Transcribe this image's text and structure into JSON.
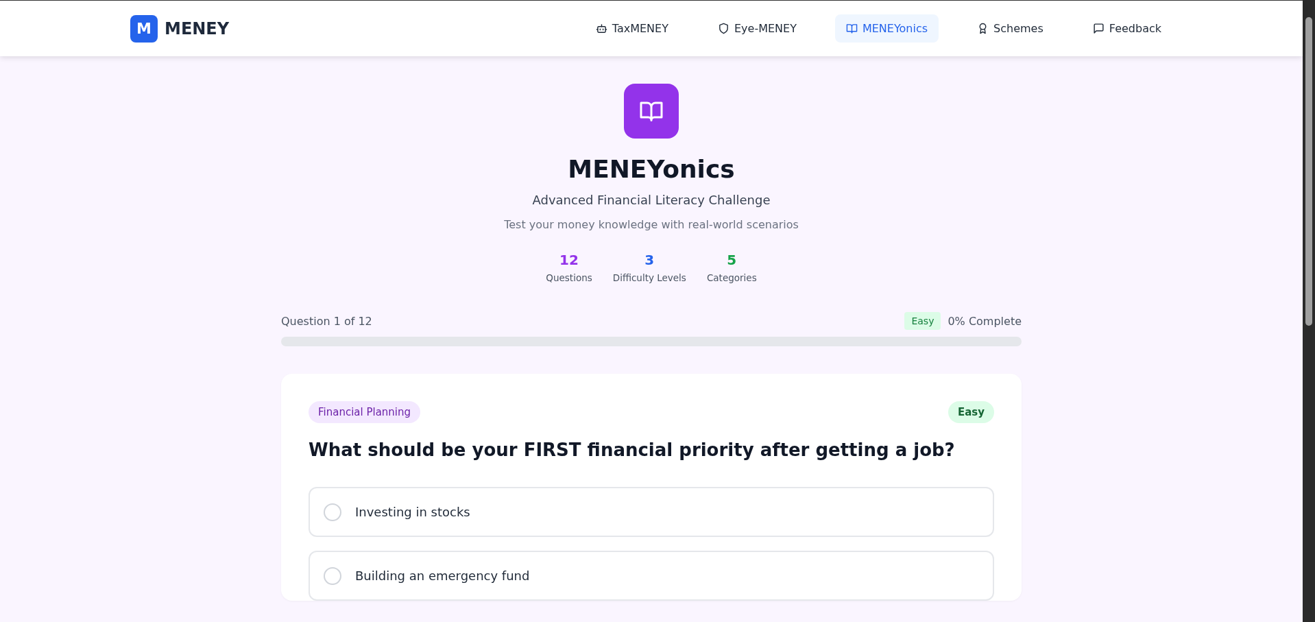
{
  "brand": {
    "mark": "M",
    "name": "MENEY"
  },
  "nav": [
    {
      "label": "TaxMENEY",
      "kind": "robot",
      "selected": false
    },
    {
      "label": "Eye-MENEY",
      "kind": "shield",
      "selected": false
    },
    {
      "label": "MENEYonics",
      "kind": "book",
      "selected": true
    },
    {
      "label": "Schemes",
      "kind": "award",
      "selected": false
    },
    {
      "label": "Feedback",
      "kind": "message",
      "selected": false
    }
  ],
  "hero": {
    "title": "MENEYonics",
    "subtitle": "Advanced Financial Literacy Challenge",
    "tagline": "Test your money knowledge with real-world scenarios"
  },
  "stats": [
    {
      "value": "12",
      "label": "Questions",
      "color": "#9333ea"
    },
    {
      "value": "3",
      "label": "Difficulty Levels",
      "color": "#2563eb"
    },
    {
      "value": "5",
      "label": "Categories",
      "color": "#16a34a"
    }
  ],
  "progress": {
    "counter": "Question 1 of 12",
    "difficulty": "Easy",
    "percent": "0% Complete",
    "level": 0
  },
  "question": {
    "category": "Financial Planning",
    "difficulty": "Easy",
    "text": "What should be your FIRST financial priority after getting a job?",
    "options": [
      {
        "text": "Investing in stocks",
        "selected": false
      },
      {
        "text": "Building an emergency fund",
        "selected": false
      }
    ]
  }
}
